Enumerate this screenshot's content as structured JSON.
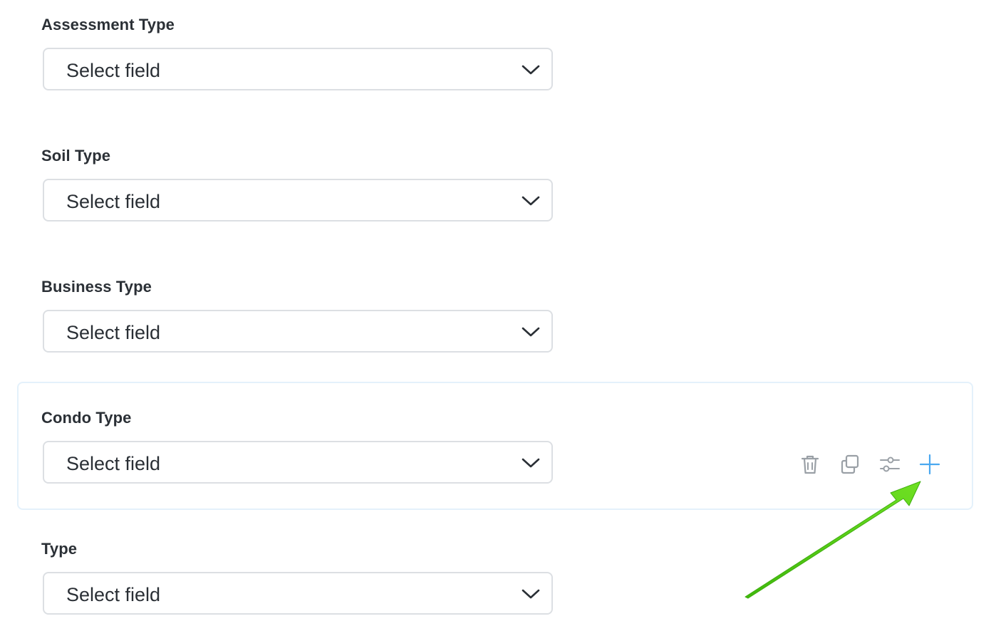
{
  "fields": [
    {
      "label": "Assessment Type",
      "value": "Select field"
    },
    {
      "label": "Soil Type",
      "value": "Select field"
    },
    {
      "label": "Business Type",
      "value": "Select field"
    },
    {
      "label": "Condo Type",
      "value": "Select field"
    },
    {
      "label": "Type",
      "value": "Select field"
    }
  ],
  "actions": {
    "icons": [
      "trash-icon",
      "copy-icon",
      "sliders-icon",
      "plus-icon"
    ]
  },
  "colors": {
    "active_border": "#e4f1fb",
    "action_gray": "#9aa0a6",
    "plus_blue": "#4aa8f0",
    "arrow_green": "#5fd61a"
  }
}
